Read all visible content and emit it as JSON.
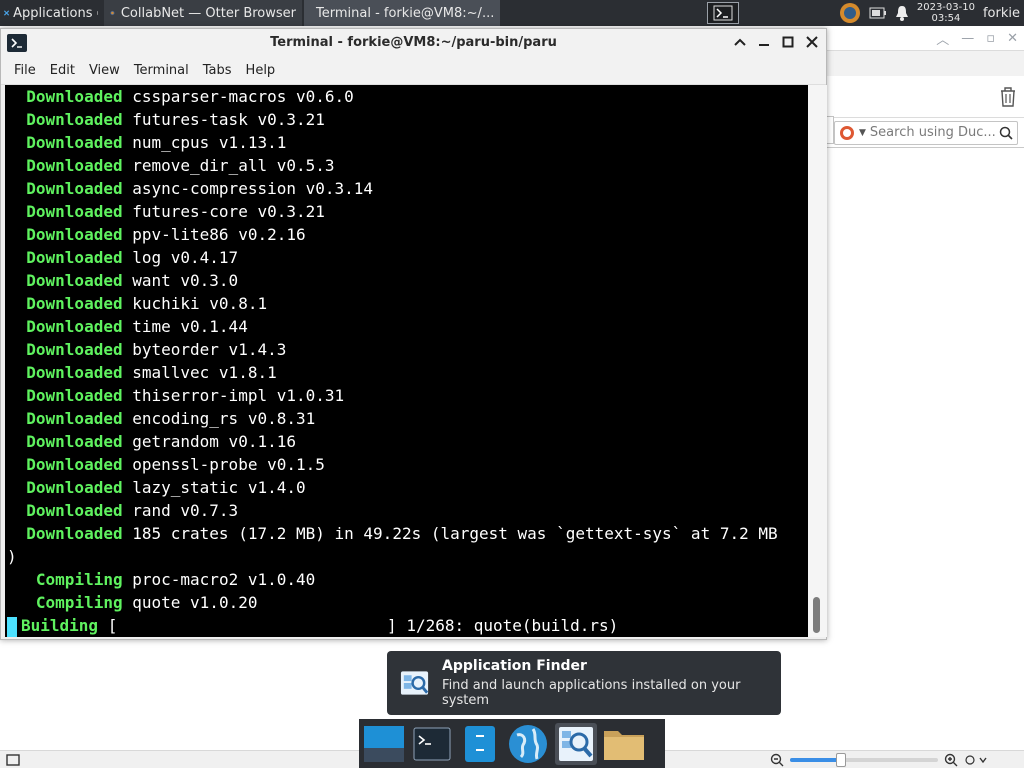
{
  "top_panel": {
    "applications_label": "Applications",
    "tasks": [
      {
        "label": "CollabNet — Otter Browser"
      },
      {
        "label": "Terminal - forkie@VM8:~/..."
      }
    ],
    "clock_date": "2023-03-10",
    "clock_time": "03:54",
    "user": "forkie"
  },
  "background_browser": {
    "search_placeholder": "Search using Duc..."
  },
  "terminal": {
    "title": "Terminal - forkie@VM8:~/paru-bin/paru",
    "menu": [
      "File",
      "Edit",
      "View",
      "Terminal",
      "Tabs",
      "Help"
    ],
    "lines": [
      {
        "keyword": "Downloaded",
        "indent": "  ",
        "text": " cssparser-macros v0.6.0"
      },
      {
        "keyword": "Downloaded",
        "indent": "  ",
        "text": " futures-task v0.3.21"
      },
      {
        "keyword": "Downloaded",
        "indent": "  ",
        "text": " num_cpus v1.13.1"
      },
      {
        "keyword": "Downloaded",
        "indent": "  ",
        "text": " remove_dir_all v0.5.3"
      },
      {
        "keyword": "Downloaded",
        "indent": "  ",
        "text": " async-compression v0.3.14"
      },
      {
        "keyword": "Downloaded",
        "indent": "  ",
        "text": " futures-core v0.3.21"
      },
      {
        "keyword": "Downloaded",
        "indent": "  ",
        "text": " ppv-lite86 v0.2.16"
      },
      {
        "keyword": "Downloaded",
        "indent": "  ",
        "text": " log v0.4.17"
      },
      {
        "keyword": "Downloaded",
        "indent": "  ",
        "text": " want v0.3.0"
      },
      {
        "keyword": "Downloaded",
        "indent": "  ",
        "text": " kuchiki v0.8.1"
      },
      {
        "keyword": "Downloaded",
        "indent": "  ",
        "text": " time v0.1.44"
      },
      {
        "keyword": "Downloaded",
        "indent": "  ",
        "text": " byteorder v1.4.3"
      },
      {
        "keyword": "Downloaded",
        "indent": "  ",
        "text": " smallvec v1.8.1"
      },
      {
        "keyword": "Downloaded",
        "indent": "  ",
        "text": " thiserror-impl v1.0.31"
      },
      {
        "keyword": "Downloaded",
        "indent": "  ",
        "text": " encoding_rs v0.8.31"
      },
      {
        "keyword": "Downloaded",
        "indent": "  ",
        "text": " getrandom v0.1.16"
      },
      {
        "keyword": "Downloaded",
        "indent": "  ",
        "text": " openssl-probe v0.1.5"
      },
      {
        "keyword": "Downloaded",
        "indent": "  ",
        "text": " lazy_static v1.4.0"
      },
      {
        "keyword": "Downloaded",
        "indent": "  ",
        "text": " rand v0.7.3"
      },
      {
        "keyword": "Downloaded",
        "indent": "  ",
        "text": " 185 crates (17.2 MB) in 49.22s (largest was `gettext-sys` at 7.2 MB"
      },
      {
        "keyword": "",
        "indent": "",
        "text": ")"
      },
      {
        "keyword": "Compiling",
        "indent": "   ",
        "text": " proc-macro2 v1.0.40"
      },
      {
        "keyword": "Compiling",
        "indent": "   ",
        "text": " quote v1.0.20"
      }
    ],
    "progress_line": {
      "keyword": "Building",
      "text": " [                            ] 1/268: quote(build.rs)"
    }
  },
  "notification": {
    "title": "Application Finder",
    "body": "Find and launch applications installed on your system"
  },
  "dock": {
    "items": [
      "show-desktop",
      "terminal",
      "file-manager-app",
      "web-browser",
      "app-finder",
      "home-folder"
    ]
  },
  "colors": {
    "terminal_bg": "#000000",
    "terminal_keyword": "#5ff25f",
    "cursor": "#4de1ff",
    "panel_bg": "#2b2e33"
  }
}
